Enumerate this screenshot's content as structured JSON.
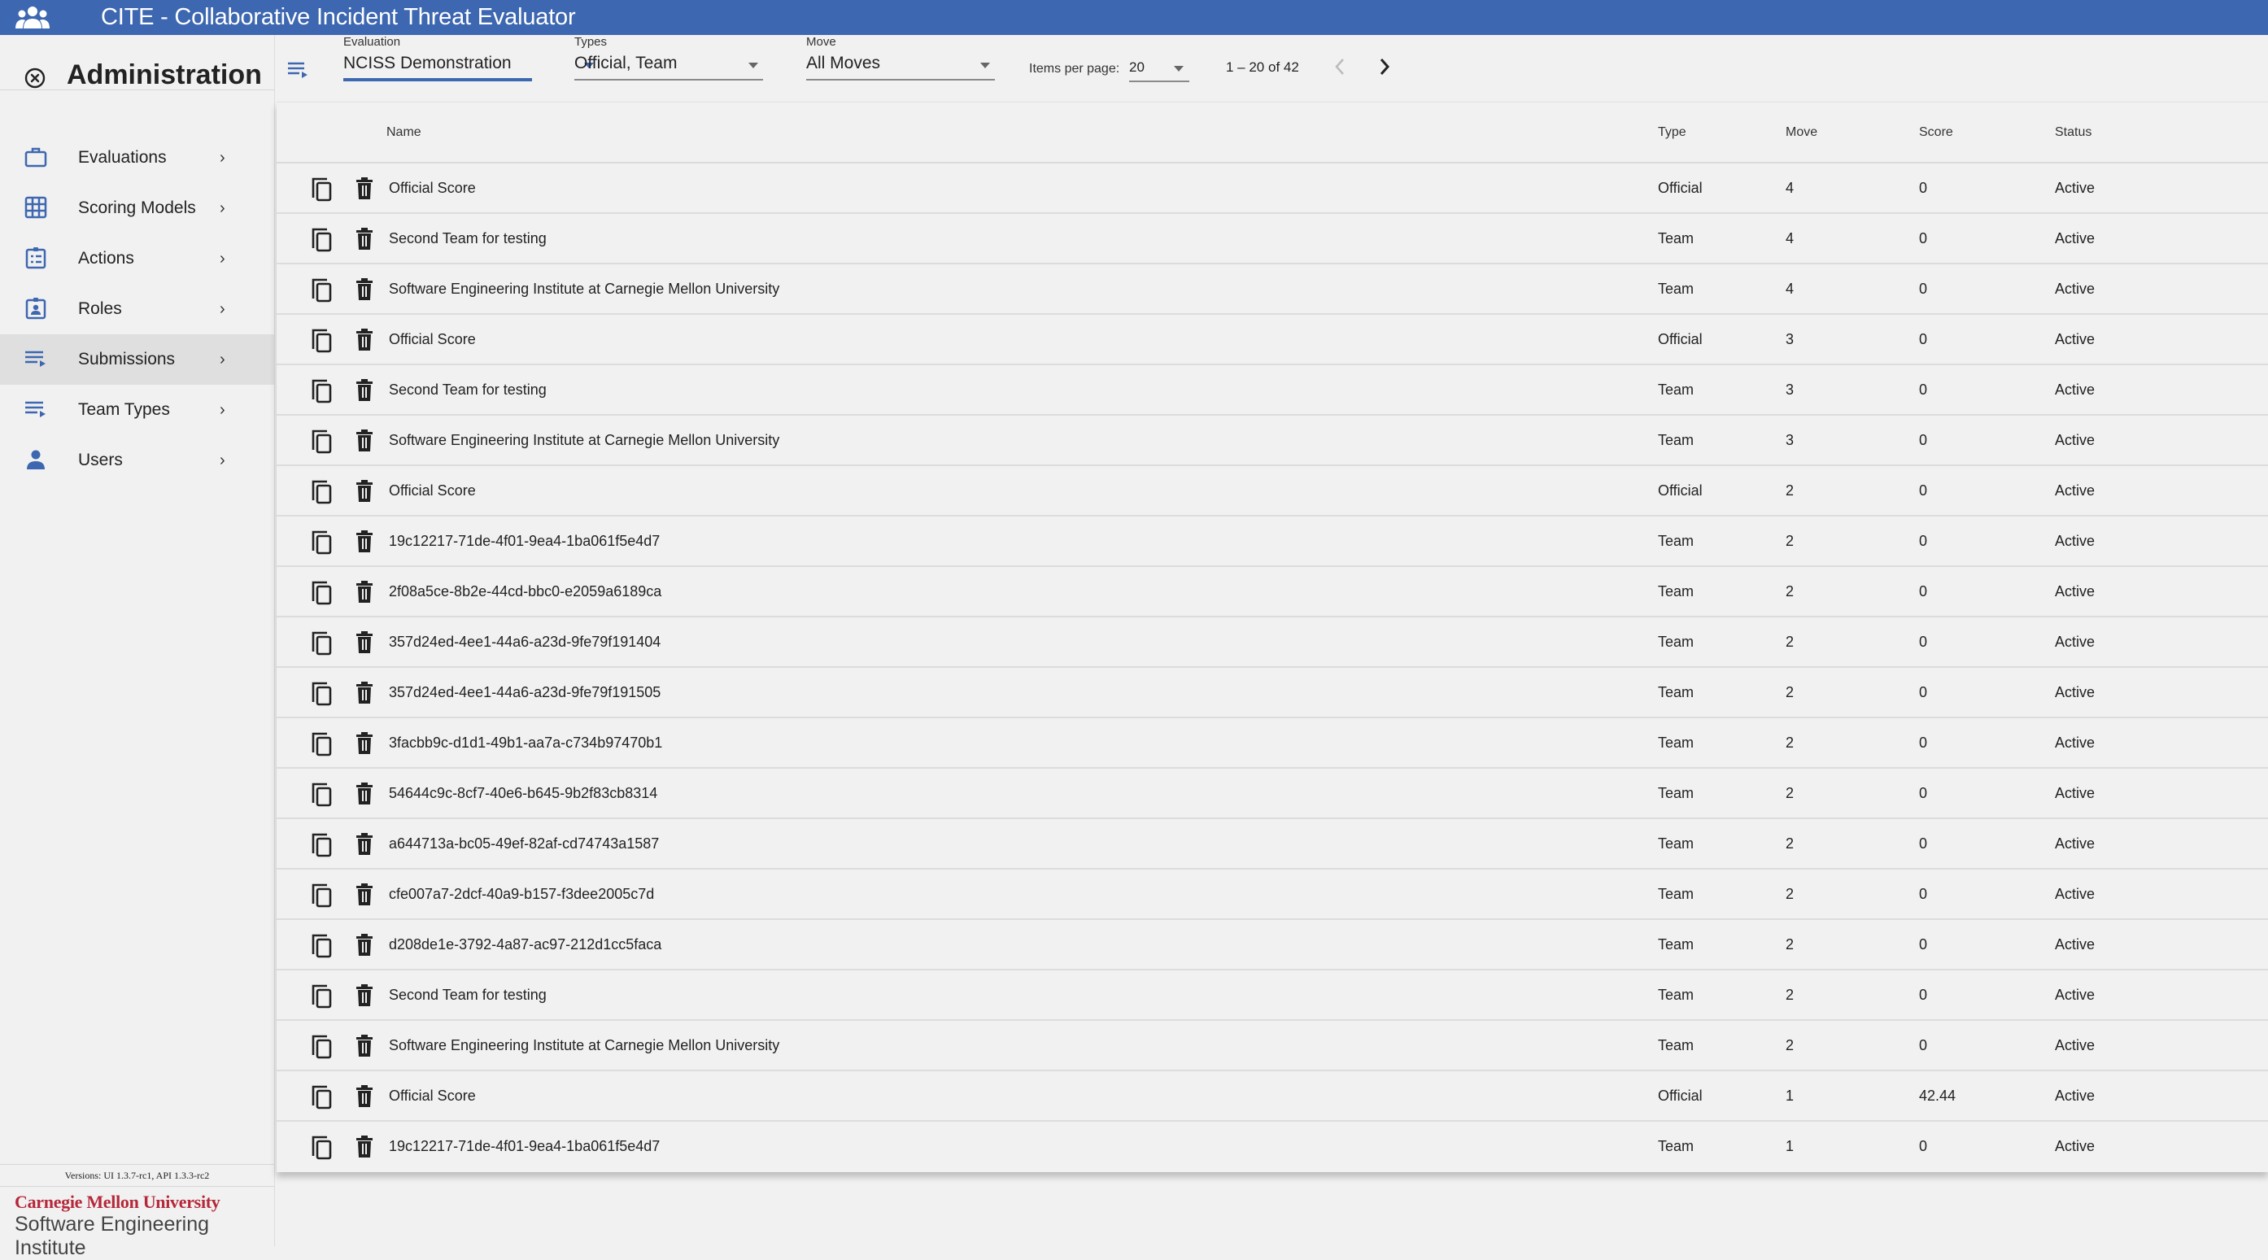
{
  "app": {
    "title": "CITE - Collaborative Incident Threat Evaluator",
    "logo_icon": "groups-icon",
    "brand_color": "#3d67b0"
  },
  "sidebar": {
    "heading": "Administration",
    "close_icon": "close-circle-icon",
    "items": [
      {
        "label": "Evaluations",
        "icon": "briefcase-icon",
        "selected": false
      },
      {
        "label": "Scoring Models",
        "icon": "grid-icon",
        "selected": false
      },
      {
        "label": "Actions",
        "icon": "numbered-list-clipboard-icon",
        "selected": false
      },
      {
        "label": "Roles",
        "icon": "badge-clipboard-icon",
        "selected": false
      },
      {
        "label": "Submissions",
        "icon": "playlist-play-icon",
        "selected": true
      },
      {
        "label": "Team Types",
        "icon": "playlist-play-icon",
        "selected": false
      },
      {
        "label": "Users",
        "icon": "person-icon",
        "selected": false
      }
    ],
    "chevron": "›",
    "versions": "Versions: UI 1.3.7-rc1, API 1.3.3-rc2",
    "footer_org": "Carnegie Mellon University",
    "footer_inst": "Software Engineering Institute"
  },
  "filters": {
    "evaluation": {
      "label": "Evaluation",
      "value": "NCISS Demonstration"
    },
    "types": {
      "label": "Types",
      "value": "Official, Team"
    },
    "move": {
      "label": "Move",
      "value": "All Moves"
    },
    "items_per_page_label": "Items per page:",
    "items_per_page": "20",
    "range": "1 – 20 of 42",
    "prev_label": "‹",
    "next_label": "›"
  },
  "table": {
    "headers": {
      "name": "Name",
      "type": "Type",
      "move": "Move",
      "score": "Score",
      "status": "Status"
    },
    "rows": [
      {
        "name": "Official Score",
        "type": "Official",
        "move": "4",
        "score": "0",
        "status": "Active"
      },
      {
        "name": "Second Team for testing",
        "type": "Team",
        "move": "4",
        "score": "0",
        "status": "Active"
      },
      {
        "name": "Software Engineering Institute at Carnegie Mellon University",
        "type": "Team",
        "move": "4",
        "score": "0",
        "status": "Active"
      },
      {
        "name": "Official Score",
        "type": "Official",
        "move": "3",
        "score": "0",
        "status": "Active"
      },
      {
        "name": "Second Team for testing",
        "type": "Team",
        "move": "3",
        "score": "0",
        "status": "Active"
      },
      {
        "name": "Software Engineering Institute at Carnegie Mellon University",
        "type": "Team",
        "move": "3",
        "score": "0",
        "status": "Active"
      },
      {
        "name": "Official Score",
        "type": "Official",
        "move": "2",
        "score": "0",
        "status": "Active"
      },
      {
        "name": "19c12217-71de-4f01-9ea4-1ba061f5e4d7",
        "type": "Team",
        "move": "2",
        "score": "0",
        "status": "Active"
      },
      {
        "name": "2f08a5ce-8b2e-44cd-bbc0-e2059a6189ca",
        "type": "Team",
        "move": "2",
        "score": "0",
        "status": "Active"
      },
      {
        "name": "357d24ed-4ee1-44a6-a23d-9fe79f191404",
        "type": "Team",
        "move": "2",
        "score": "0",
        "status": "Active"
      },
      {
        "name": "357d24ed-4ee1-44a6-a23d-9fe79f191505",
        "type": "Team",
        "move": "2",
        "score": "0",
        "status": "Active"
      },
      {
        "name": "3facbb9c-d1d1-49b1-aa7a-c734b97470b1",
        "type": "Team",
        "move": "2",
        "score": "0",
        "status": "Active"
      },
      {
        "name": "54644c9c-8cf7-40e6-b645-9b2f83cb8314",
        "type": "Team",
        "move": "2",
        "score": "0",
        "status": "Active"
      },
      {
        "name": "a644713a-bc05-49ef-82af-cd74743a1587",
        "type": "Team",
        "move": "2",
        "score": "0",
        "status": "Active"
      },
      {
        "name": "cfe007a7-2dcf-40a9-b157-f3dee2005c7d",
        "type": "Team",
        "move": "2",
        "score": "0",
        "status": "Active"
      },
      {
        "name": "d208de1e-3792-4a87-ac97-212d1cc5faca",
        "type": "Team",
        "move": "2",
        "score": "0",
        "status": "Active"
      },
      {
        "name": "Second Team for testing",
        "type": "Team",
        "move": "2",
        "score": "0",
        "status": "Active"
      },
      {
        "name": "Software Engineering Institute at Carnegie Mellon University",
        "type": "Team",
        "move": "2",
        "score": "0",
        "status": "Active"
      },
      {
        "name": "Official Score",
        "type": "Official",
        "move": "1",
        "score": "42.44",
        "status": "Active"
      },
      {
        "name": "19c12217-71de-4f01-9ea4-1ba061f5e4d7",
        "type": "Team",
        "move": "1",
        "score": "0",
        "status": "Active"
      }
    ],
    "row_actions": {
      "copy_icon": "copy-icon",
      "delete_icon": "trash-icon"
    }
  }
}
